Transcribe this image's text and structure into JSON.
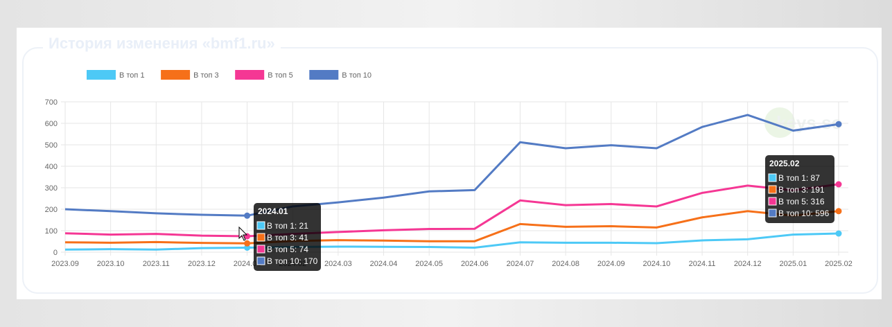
{
  "title": "История изменения «bmf1.ru»",
  "watermark": "keys.so",
  "chart_data": {
    "type": "line",
    "categories": [
      "2023.09",
      "2023.10",
      "2023.11",
      "2023.12",
      "2024.01",
      "2024.02",
      "2024.03",
      "2024.04",
      "2024.05",
      "2024.06",
      "2024.07",
      "2024.08",
      "2024.09",
      "2024.10",
      "2024.11",
      "2024.12",
      "2025.01",
      "2025.02"
    ],
    "ylim": [
      0,
      700
    ],
    "yticks": [
      0,
      100,
      200,
      300,
      400,
      500,
      600,
      700
    ],
    "grid": true,
    "legend": "top-left",
    "series": [
      {
        "name": "В топ 1",
        "color": "#4dc9f6",
        "values": [
          12,
          14,
          12,
          19,
          21,
          24,
          26,
          25,
          24,
          21,
          46,
          44,
          44,
          42,
          55,
          60,
          82,
          87
        ]
      },
      {
        "name": "В топ 3",
        "color": "#f67019",
        "values": [
          46,
          44,
          47,
          43,
          41,
          52,
          56,
          54,
          51,
          51,
          131,
          118,
          121,
          115,
          162,
          191,
          170,
          191
        ]
      },
      {
        "name": "В топ 5",
        "color": "#f53794",
        "values": [
          88,
          82,
          85,
          77,
          74,
          85,
          94,
          102,
          108,
          109,
          241,
          219,
          224,
          213,
          276,
          310,
          288,
          316
        ]
      },
      {
        "name": "В топ 10",
        "color": "#537bc4",
        "values": [
          200,
          191,
          181,
          174,
          170,
          213,
          232,
          254,
          283,
          289,
          512,
          484,
          498,
          484,
          583,
          639,
          566,
          596
        ]
      }
    ],
    "tooltips": [
      {
        "title": "2024.01",
        "lines": [
          "В топ 1: 21",
          "В топ 3: 41",
          "В топ 5: 74",
          "В топ 10: 170"
        ]
      },
      {
        "title": "2025.02",
        "lines": [
          "В топ 1: 87",
          "В топ 3: 191",
          "В топ 5: 316",
          "В топ 10: 596"
        ]
      }
    ]
  }
}
